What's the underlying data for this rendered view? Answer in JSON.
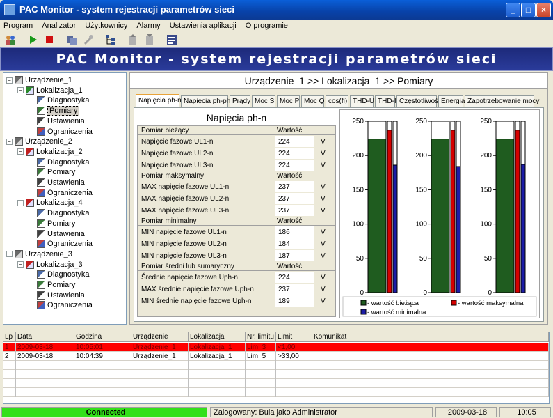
{
  "window": {
    "title": "PAC Monitor - system rejestracji parametrów sieci"
  },
  "menu": [
    "Program",
    "Analizator",
    "Użytkownicy",
    "Alarmy",
    "Ustawienia aplikacji",
    "O programie"
  ],
  "banner": "PAC Monitor - system rejestracji parametrów sieci",
  "tree": {
    "items": [
      {
        "label": "Urządzenie_1",
        "level": 0,
        "icon": "device-icon",
        "expanded": true
      },
      {
        "label": "Lokalizacja_1",
        "level": 1,
        "icon": "location-icon",
        "expanded": true
      },
      {
        "label": "Diagnostyka",
        "level": 2,
        "icon": "diagnostics-icon"
      },
      {
        "label": "Pomiary",
        "level": 2,
        "icon": "measurements-icon",
        "selected": true
      },
      {
        "label": "Ustawienia",
        "level": 2,
        "icon": "settings-icon"
      },
      {
        "label": "Ograniczenia",
        "level": 2,
        "icon": "limits-icon"
      },
      {
        "label": "Urządzenie_2",
        "level": 0,
        "icon": "device-icon",
        "expanded": true
      },
      {
        "label": "Lokalizacja_2",
        "level": 1,
        "icon": "location-alarm-icon",
        "expanded": true
      },
      {
        "label": "Diagnostyka",
        "level": 2,
        "icon": "diagnostics-icon"
      },
      {
        "label": "Pomiary",
        "level": 2,
        "icon": "measurements-icon"
      },
      {
        "label": "Ustawienia",
        "level": 2,
        "icon": "settings-icon"
      },
      {
        "label": "Ograniczenia",
        "level": 2,
        "icon": "limits-icon"
      },
      {
        "label": "Lokalizacja_4",
        "level": 1,
        "icon": "location-alarm-icon",
        "expanded": true
      },
      {
        "label": "Diagnostyka",
        "level": 2,
        "icon": "diagnostics-icon"
      },
      {
        "label": "Pomiary",
        "level": 2,
        "icon": "measurements-icon"
      },
      {
        "label": "Ustawienia",
        "level": 2,
        "icon": "settings-icon"
      },
      {
        "label": "Ograniczenia",
        "level": 2,
        "icon": "limits-icon"
      },
      {
        "label": "Urządzenie_3",
        "level": 0,
        "icon": "device-icon",
        "expanded": true
      },
      {
        "label": "Lokalizacja_3",
        "level": 1,
        "icon": "location-alarm-icon",
        "expanded": true
      },
      {
        "label": "Diagnostyka",
        "level": 2,
        "icon": "diagnostics-icon"
      },
      {
        "label": "Pomiary",
        "level": 2,
        "icon": "measurements-icon"
      },
      {
        "label": "Ustawienia",
        "level": 2,
        "icon": "settings-icon"
      },
      {
        "label": "Ograniczenia",
        "level": 2,
        "icon": "limits-icon"
      }
    ]
  },
  "breadcrumb": "Urządzenie_1 >> Lokalizacja_1 >> Pomiary",
  "tabs": [
    "Napięcia ph-n",
    "Napięcia ph-ph",
    "Prądy",
    "Moc S",
    "Moc P",
    "Moc Q",
    "cos(fi)",
    "THD-U",
    "THD-I",
    "Częstotliwość",
    "Energia",
    "Zapotrzebowanie mocy"
  ],
  "active_tab": "Napięcia ph-n",
  "grid": {
    "title": "Napięcia ph-n",
    "groups": [
      {
        "header": "Pomiar bieżący",
        "value_header": "Wartość",
        "rows": [
          {
            "label": "Napięcie fazowe UL1-n",
            "value": "224",
            "unit": "V"
          },
          {
            "label": "Napięcie fazowe UL2-n",
            "value": "224",
            "unit": "V"
          },
          {
            "label": "Napięcie fazowe UL3-n",
            "value": "224",
            "unit": "V"
          }
        ]
      },
      {
        "header": "Pomiar maksymalny",
        "value_header": "Wartość",
        "rows": [
          {
            "label": "MAX napięcie fazowe UL1-n",
            "value": "237",
            "unit": "V"
          },
          {
            "label": "MAX napięcie fazowe UL2-n",
            "value": "237",
            "unit": "V"
          },
          {
            "label": "MAX napięcie fazowe UL3-n",
            "value": "237",
            "unit": "V"
          }
        ]
      },
      {
        "header": "Pomiar minimalny",
        "value_header": "Wartość",
        "rows": [
          {
            "label": "MIN napięcie fazowe UL1-n",
            "value": "186",
            "unit": "V"
          },
          {
            "label": "MIN napięcie fazowe UL2-n",
            "value": "184",
            "unit": "V"
          },
          {
            "label": "MIN napięcie fazowe UL3-n",
            "value": "187",
            "unit": "V"
          }
        ]
      },
      {
        "header": "Pomiar średni lub sumaryczny",
        "value_header": "Wartość",
        "rows": [
          {
            "label": "Średnie napięcie fazowe Uph-n",
            "value": "224",
            "unit": "V"
          },
          {
            "label": "MAX średnie napięcie fazowe Uph-n",
            "value": "237",
            "unit": "V"
          },
          {
            "label": "MIN średnie napięcie fazowe Uph-n",
            "value": "189",
            "unit": "V"
          }
        ]
      }
    ]
  },
  "chart_data": {
    "type": "bar",
    "ylim": [
      0,
      250
    ],
    "yticks": [
      0,
      50,
      100,
      150,
      200,
      250
    ],
    "groups": [
      {
        "current": 224,
        "max": 237,
        "min": 186
      },
      {
        "current": 224,
        "max": 237,
        "min": 184
      },
      {
        "current": 224,
        "max": 237,
        "min": 187
      }
    ],
    "series": [
      {
        "name": " - wartość bieżąca",
        "color": "#1f5c1f"
      },
      {
        "name": " - wartość maksymalna",
        "color": "#d40000"
      },
      {
        "name": " - wartość minimalna",
        "color": "#1c1ca6"
      }
    ]
  },
  "log": {
    "headers": [
      "Lp",
      "Data",
      "Godzina",
      "Urządzenie",
      "Lokalizacja",
      "Nr. limitu",
      "Limit",
      "Komunikat"
    ],
    "rows": [
      {
        "lp": "1",
        "data": "2009-03-18",
        "godzina": "10:05:01",
        "urzadzenie": "Urządzenie_1",
        "lokalizacja": "Lokalizacja_1",
        "nr_limitu": "Lim. 3",
        "limit": "<1,00",
        "komunikat": "",
        "alarm": true
      },
      {
        "lp": "2",
        "data": "2009-03-18",
        "godzina": "10:04:39",
        "urzadzenie": "Urządzenie_1",
        "lokalizacja": "Lokalizacja_1",
        "nr_limitu": "Lim. 5",
        "limit": ">33,00",
        "komunikat": "",
        "alarm": false
      }
    ]
  },
  "status": {
    "connection": "Connected",
    "user": "Zalogowany: Bula jako Administrator",
    "date": "2009-03-18",
    "time": "10:05"
  }
}
